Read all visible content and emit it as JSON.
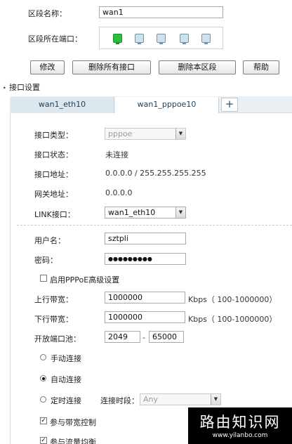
{
  "segment": {
    "name_label": "区段名称：",
    "name_value": "wan1",
    "port_label": "区段所在端口："
  },
  "toolbar": {
    "modify": "修改",
    "delete_all": "删除所有接口",
    "delete_segment": "删除本区段",
    "help": "帮助"
  },
  "section_title": "接口设置",
  "tabs": [
    "wan1_eth10",
    "wan1_pppoe10"
  ],
  "tab_add": "+",
  "fields": {
    "type_label": "接口类型：",
    "type_value": "pppoe",
    "status_label": "接口状态：",
    "status_value": "未连接",
    "addr_label": "接口地址：",
    "addr_value": "0.0.0.0 / 255.255.255.255",
    "gw_label": "网关地址：",
    "gw_value": "0.0.0.0",
    "link_label": "LINK接口：",
    "link_value": "wan1_eth10",
    "user_label": "用户名：",
    "user_value": "sztpli",
    "pwd_label": "密码：",
    "pwd_value": "●●●●●●●●●",
    "advanced_label": "启用PPPoE高级设置",
    "up_label": "上行带宽：",
    "up_value": "1000000",
    "up_unit": "Kbps（ 100-1000000）",
    "down_label": "下行带宽：",
    "down_value": "1000000",
    "down_unit": "Kbps（ 100-1000000）",
    "port_pool_label": "开放端口池：",
    "port_from": "2049",
    "port_sep": "-",
    "port_to": "65000",
    "manual_label": "手动连接",
    "auto_label": "自动连接",
    "timed_label": "定时连接",
    "period_label": "连接时段：",
    "period_value": "Any",
    "bw_ctrl_label": "参与带宽控制",
    "lb_label": "参与流量均衡"
  },
  "watermark": {
    "title": "路由知识网",
    "url": "www.yilanbo.com"
  },
  "state": {
    "advanced_checked": false,
    "connect_mode": "auto",
    "bw_ctrl_checked": true,
    "lb_checked": true
  }
}
